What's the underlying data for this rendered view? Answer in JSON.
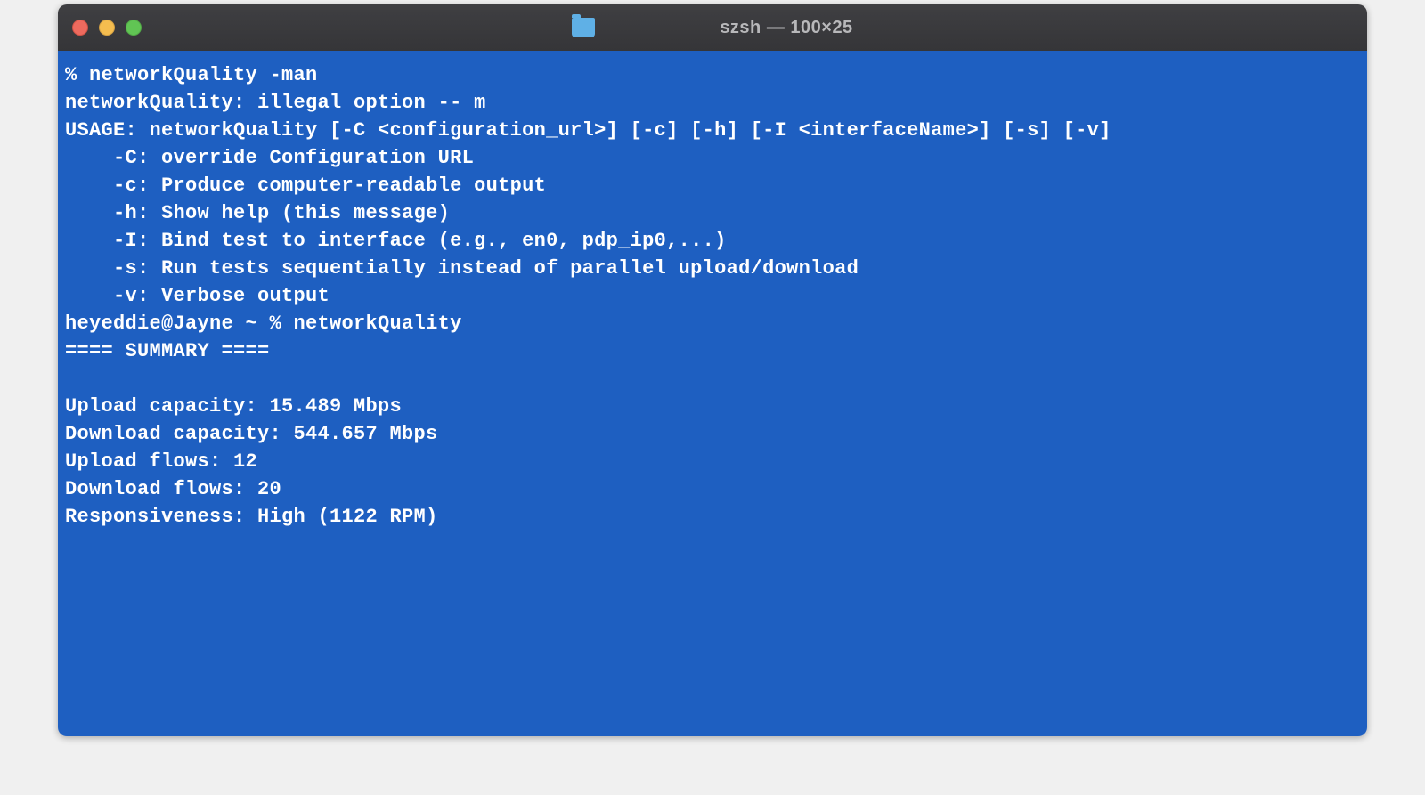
{
  "titlebar": {
    "title": "szsh — 100×25"
  },
  "terminal": {
    "lines": [
      "% networkQuality -man",
      "networkQuality: illegal option -- m",
      "USAGE: networkQuality [-C <configuration_url>] [-c] [-h] [-I <interfaceName>] [-s] [-v]",
      "    -C: override Configuration URL",
      "    -c: Produce computer-readable output",
      "    -h: Show help (this message)",
      "    -I: Bind test to interface (e.g., en0, pdp_ip0,...)",
      "    -s: Run tests sequentially instead of parallel upload/download",
      "    -v: Verbose output",
      "heyeddie@Jayne ~ % networkQuality",
      "==== SUMMARY ====",
      "",
      "Upload capacity: 15.489 Mbps",
      "Download capacity: 544.657 Mbps",
      "Upload flows: 12",
      "Download flows: 20",
      "Responsiveness: High (1122 RPM)"
    ]
  }
}
